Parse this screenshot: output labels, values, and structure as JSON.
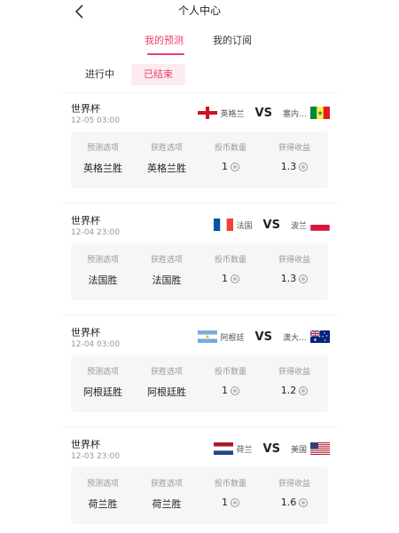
{
  "header": {
    "title": "个人中心"
  },
  "tabs": [
    {
      "label": "我的预测",
      "active": true
    },
    {
      "label": "我的订阅",
      "active": false
    }
  ],
  "filters": [
    {
      "label": "进行中",
      "active": false
    },
    {
      "label": "已结束",
      "active": true
    }
  ],
  "columns": {
    "prediction": "预测选项",
    "winning": "获胜选项",
    "coins": "投币数量",
    "earnings": "获得收益"
  },
  "colors": {
    "accent": "#ec3e69",
    "card_bg": "#f6f6f6"
  },
  "matches": [
    {
      "league": "世界杯",
      "time": "12-05 03:00",
      "home": {
        "name": "英格兰",
        "flag": "england-flag-icon"
      },
      "vs": "VS",
      "away": {
        "name": "塞内…",
        "flag": "senegal-flag-icon"
      },
      "prediction": "英格兰胜",
      "winning": "英格兰胜",
      "coins": "1",
      "earnings": "1.3"
    },
    {
      "league": "世界杯",
      "time": "12-04 23:00",
      "home": {
        "name": "法国",
        "flag": "france-flag-icon"
      },
      "vs": "VS",
      "away": {
        "name": "波兰",
        "flag": "poland-flag-icon"
      },
      "prediction": "法国胜",
      "winning": "法国胜",
      "coins": "1",
      "earnings": "1.3"
    },
    {
      "league": "世界杯",
      "time": "12-04 03:00",
      "home": {
        "name": "阿根廷",
        "flag": "argentina-flag-icon"
      },
      "vs": "VS",
      "away": {
        "name": "澳大…",
        "flag": "australia-flag-icon"
      },
      "prediction": "阿根廷胜",
      "winning": "阿根廷胜",
      "coins": "1",
      "earnings": "1.2"
    },
    {
      "league": "世界杯",
      "time": "12-03 23:00",
      "home": {
        "name": "荷兰",
        "flag": "netherlands-flag-icon"
      },
      "vs": "VS",
      "away": {
        "name": "美国",
        "flag": "usa-flag-icon"
      },
      "prediction": "荷兰胜",
      "winning": "荷兰胜",
      "coins": "1",
      "earnings": "1.6"
    }
  ]
}
